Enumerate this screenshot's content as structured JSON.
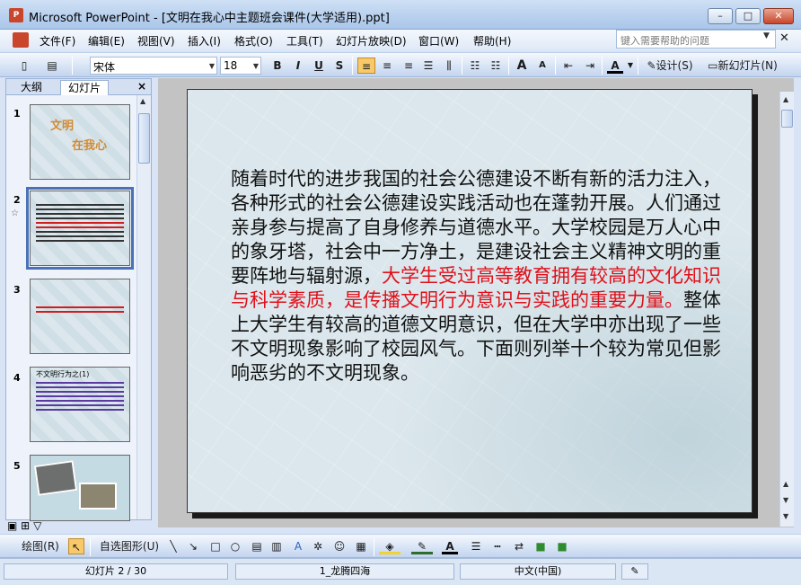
{
  "window": {
    "app_icon": "P",
    "title": "Microsoft PowerPoint - [文明在我心中主题班会课件(大学适用).ppt]",
    "minimize": "–",
    "maximize": "□",
    "close": "✕"
  },
  "menu": {
    "items": [
      "文件(F)",
      "编辑(E)",
      "视图(V)",
      "插入(I)",
      "格式(O)",
      "工具(T)",
      "幻灯片放映(D)",
      "窗口(W)",
      "帮助(H)"
    ],
    "help_placeholder": "键入需要帮助的问题",
    "help_drop": "▼",
    "doc_close": "✕"
  },
  "toolbar": {
    "font": "宋体",
    "size": "18",
    "bold": "B",
    "italic": "I",
    "underline": "U",
    "shadow": "S",
    "grow": "A",
    "shrink": "A",
    "font_color": "A",
    "design": "设计(S)",
    "new_slide": "新幻灯片(N)"
  },
  "left_pane": {
    "tab_outline": "大纲",
    "tab_slides": "幻灯片",
    "close": "×",
    "slides": [
      {
        "num": "1",
        "line1": "文明",
        "line2": "在我心"
      },
      {
        "num": "2",
        "selected": true
      },
      {
        "num": "3"
      },
      {
        "num": "4",
        "line1": "不文明行为之(1)"
      },
      {
        "num": "5"
      }
    ],
    "star": "☆"
  },
  "slide": {
    "text_normal_1": "随着时代的进步我国的社会公德建设不断有新的活力注入，各种形式的社会公德建设实践活动也在蓬勃开展。人们通过亲身参与提高了自身修养与道德水平。大学校园是万人心中的象牙塔，社会中一方净土，是建设社会主义精神文明的重要阵地与辐射源，",
    "text_red": "大学生受过高等教育拥有较高的文化知识与科学素质，是传播文明行为意识与实践的重要力量。",
    "text_normal_2": "整体上大学生有较高的道德文明意识，但在大学中亦出现了一些不文明现象影响了校园风气。下面则列举十个较为常见但影响恶劣的不文明现象。"
  },
  "drawbar": {
    "draw": "绘图(R)",
    "autoshape": "自选图形(U)"
  },
  "status": {
    "slide_info": "幻灯片 2 / 30",
    "template": "1_龙腾四海",
    "language": "中文(中国)"
  },
  "colors": {
    "red_text": "#e0101a",
    "thumb_title": "#d28a33",
    "selection": "#4a72b6"
  }
}
